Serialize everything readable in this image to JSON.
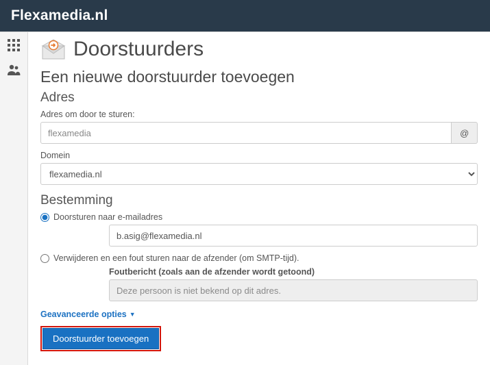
{
  "brand": "Flexamedia.nl",
  "page": {
    "title": "Doorstuurders"
  },
  "form": {
    "heading": "Een nieuwe doorstuurder toevoegen",
    "address": {
      "group_title": "Adres",
      "label": "Adres om door te sturen:",
      "placeholder": "flexamedia",
      "at_label": "@",
      "domain_label": "Domein",
      "domain_value": "flexamedia.nl"
    },
    "destination": {
      "group_title": "Bestemming",
      "forward_label": "Doorsturen naar e-mailadres",
      "forward_value": "b.asig@flexamedia.nl",
      "delete_label": "Verwijderen en een fout sturen naar de afzender (om SMTP-tijd).",
      "failure_label": "Foutbericht (zoals aan de afzender wordt getoond)",
      "failure_value": "Deze persoon is niet bekend op dit adres."
    },
    "advanced_label": "Geavanceerde opties",
    "submit_label": "Doorstuurder toevoegen"
  }
}
